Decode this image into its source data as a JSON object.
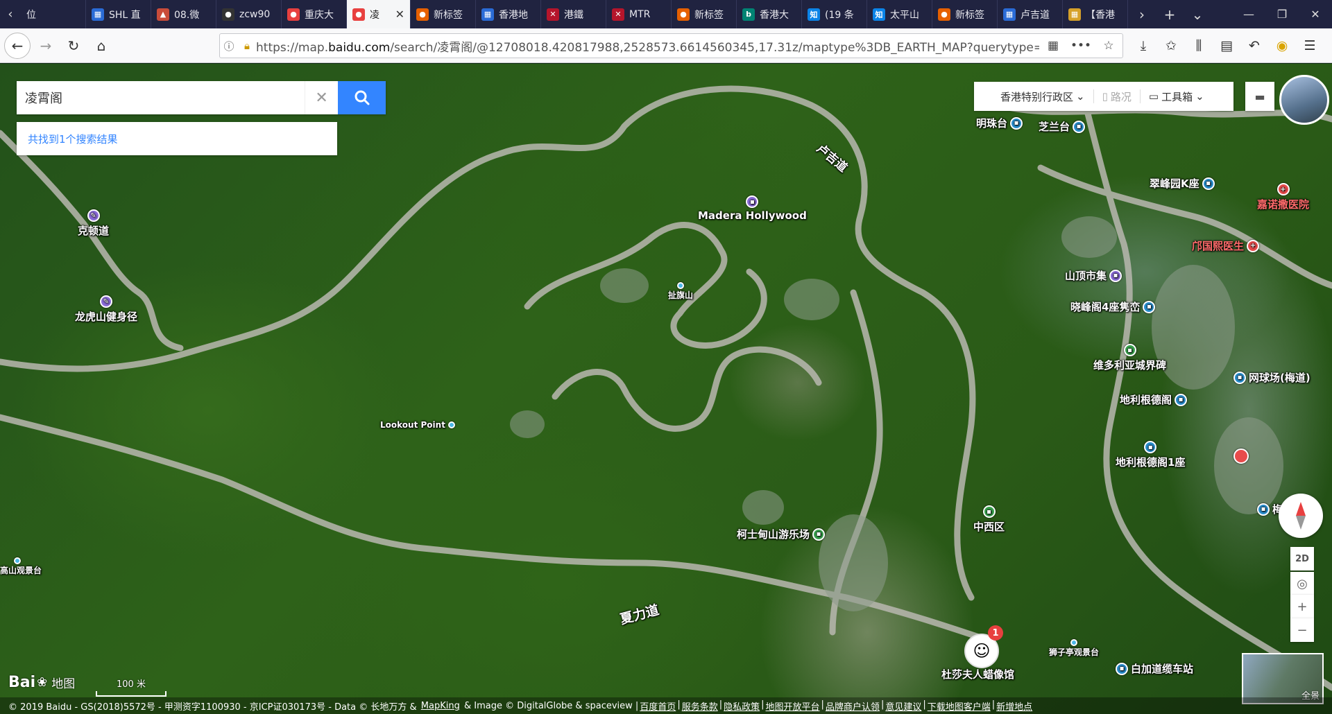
{
  "browser": {
    "tabs": [
      {
        "label": "位",
        "color": "#202340",
        "glyph": ""
      },
      {
        "label": "SHL 直",
        "color": "#2a6bd6",
        "glyph": "▦"
      },
      {
        "label": "08.微",
        "color": "#c94c3a",
        "glyph": "▲"
      },
      {
        "label": "zcw90",
        "color": "#333333",
        "glyph": "●"
      },
      {
        "label": "重庆大",
        "color": "#e8403f",
        "glyph": "●"
      },
      {
        "label": "凌",
        "color": "#e8403f",
        "glyph": "●",
        "active": true
      },
      {
        "label": "新标签",
        "color": "#e66000",
        "glyph": "●"
      },
      {
        "label": "香港地",
        "color": "#2a6bd6",
        "glyph": "▦"
      },
      {
        "label": "港鐵",
        "color": "#b5152b",
        "glyph": "✕"
      },
      {
        "label": "MTR",
        "color": "#b5152b",
        "glyph": "✕"
      },
      {
        "label": "新标签",
        "color": "#e66000",
        "glyph": "●"
      },
      {
        "label": "香港大",
        "color": "#008373",
        "glyph": "b"
      },
      {
        "label": "(19 条",
        "color": "#0b84e8",
        "glyph": "知"
      },
      {
        "label": "太平山",
        "color": "#0b84e8",
        "glyph": "知"
      },
      {
        "label": "新标签",
        "color": "#e66000",
        "glyph": "●"
      },
      {
        "label": "卢吉道",
        "color": "#2a6bd6",
        "glyph": "▦"
      },
      {
        "label": "【香港",
        "color": "#d6a12a",
        "glyph": "▦"
      }
    ],
    "url_prefix": "https://map.",
    "url_domain": "baidu.com",
    "url_rest": "/search/凌霄阁/@12708018.420817988,2528573.6614560345,17.31z/maptype%3DB_EARTH_MAP?querytype="
  },
  "search": {
    "value": "凌霄阁",
    "result_text": "共找到1个搜索结果"
  },
  "toolbar": {
    "region": "香港特别行政区",
    "traffic": "路况",
    "toolbox": "工具箱"
  },
  "map_labels": {
    "road_lugard": "卢吉道",
    "road_harlech": "夏力道",
    "madera": "Madera Hollywood",
    "flagstaff": "扯旗山",
    "lookout": "Lookout Point",
    "kedun": "克顿道",
    "longhu": "龙虎山健身径",
    "gaoshan": "高山观景台",
    "mingzhu": "明珠台",
    "zhilan": "芝兰台",
    "cuifeng": "翠峰园K座",
    "jianuo": "嘉诺撒医院",
    "qiuguoxi": "邝国熙医生",
    "shanding": "山顶市集",
    "xiaofeng": "晓峰阁4座隽峦",
    "victoria": "维多利亚城界碑",
    "tennis": "网球场(梅道)",
    "tiligen": "地利根德阁",
    "tiligen1": "地利根德阁1座",
    "zhongxi": "中西区",
    "kesd": "柯士甸山游乐场",
    "madame": "杜莎夫人蜡像馆",
    "shizi": "狮子亭观景台",
    "baijia": "白加道缆车站",
    "mei": "梅"
  },
  "controls": {
    "btn_2d": "2D",
    "zoom_in": "+",
    "zoom_out": "−",
    "pano": "全景",
    "marker_count": "1"
  },
  "footer": {
    "logo": "Bai",
    "logo_sub": "地图",
    "scale": "100 米",
    "copyright": "© 2019 Baidu - GS(2018)5572号 - 甲测资字1100930 - 京ICP证030173号 - Data © 长地万方 &",
    "mapking": "MapKing",
    "copyright2": "& Image © DigitalGlobe & spaceview |",
    "links": [
      "百度首页",
      "服务条款",
      "隐私政策",
      "地图开放平台",
      "品牌商户认领",
      "意见建议",
      "下载地图客户端",
      "新增地点"
    ]
  }
}
